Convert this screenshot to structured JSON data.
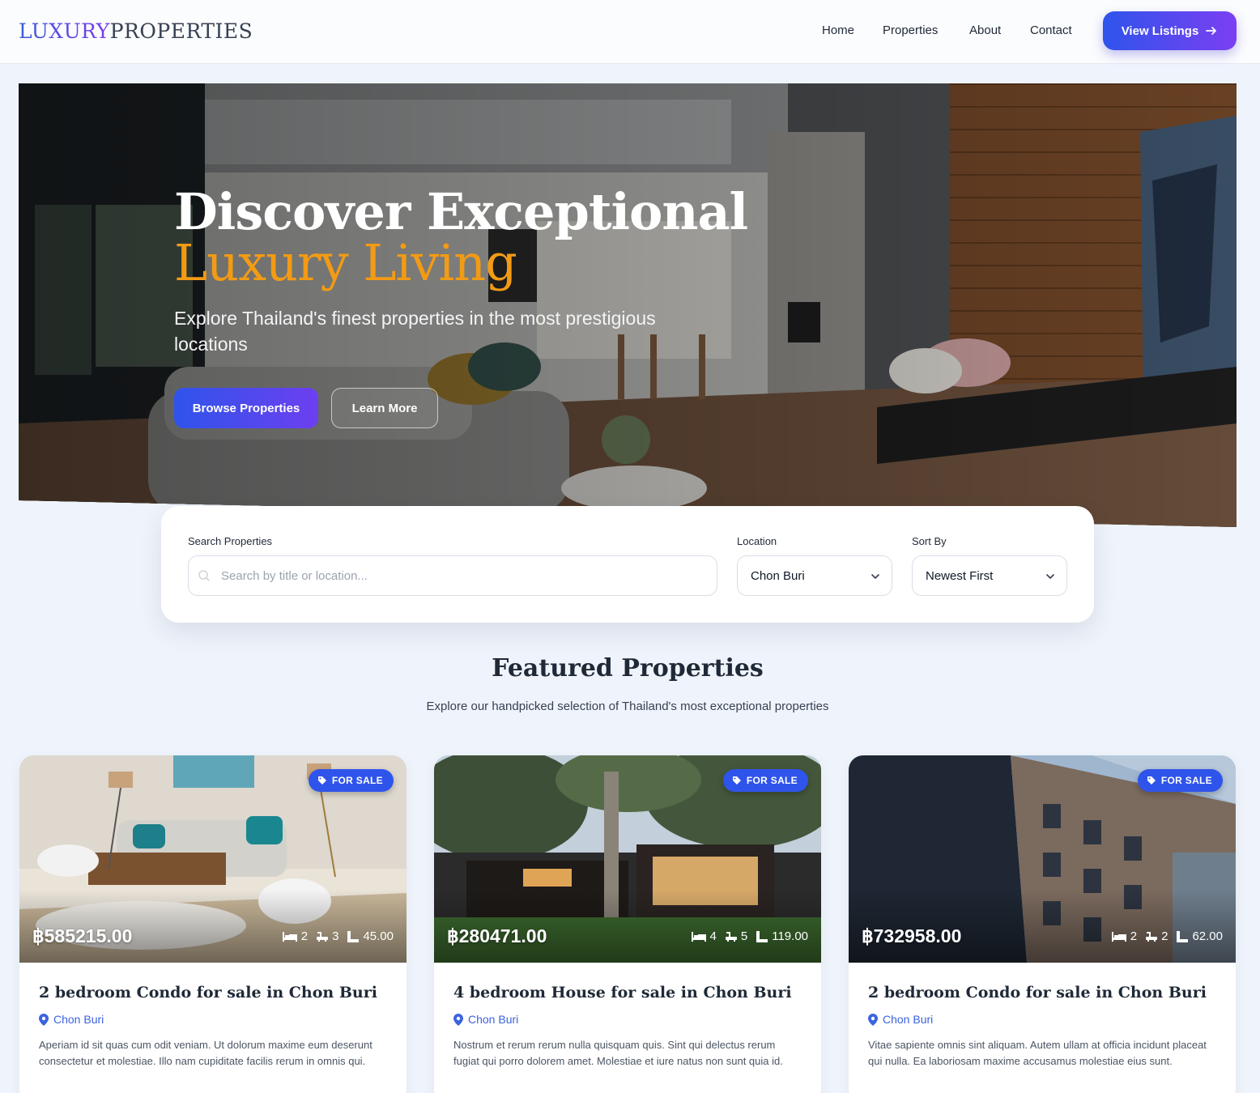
{
  "brand": {
    "logo_accent": "LUXURY",
    "logo_rest": "PROPERTIES"
  },
  "nav": {
    "items": [
      {
        "label": "Home"
      },
      {
        "label": "Properties"
      },
      {
        "label": "About"
      },
      {
        "label": "Contact"
      }
    ],
    "cta_label": "View Listings",
    "cta_icon": "arrow-right-icon"
  },
  "hero": {
    "title_line1": "Discover Exceptional",
    "title_line2": "Luxury Living",
    "subtitle": "Explore Thailand's finest properties in the most prestigious locations",
    "primary_button": "Browse Properties",
    "secondary_button": "Learn More"
  },
  "search": {
    "label": "Search Properties",
    "placeholder": "Search by title or location...",
    "location_label": "Location",
    "location_value": "Chon Buri",
    "sort_label": "Sort By",
    "sort_value": "Newest First"
  },
  "featured": {
    "title": "Featured Properties",
    "subtitle": "Explore our handpicked selection of Thailand's most exceptional properties"
  },
  "listings": [
    {
      "badge": "FOR SALE",
      "price": "฿585215.00",
      "beds": "2",
      "baths": "3",
      "area": "45.00",
      "title": "2 bedroom Condo for sale in Chon Buri",
      "location": "Chon Buri",
      "description": "Aperiam id sit quas cum odit veniam. Ut dolorum maxime eum deserunt consectetur et molestiae. Illo nam cupiditate facilis rerum in omnis qui."
    },
    {
      "badge": "FOR SALE",
      "price": "฿280471.00",
      "beds": "4",
      "baths": "5",
      "area": "119.00",
      "title": "4 bedroom House for sale in Chon Buri",
      "location": "Chon Buri",
      "description": "Nostrum et rerum rerum nulla quisquam quis. Sint qui delectus rerum fugiat qui porro dolorem amet. Molestiae et iure natus non sunt quia id."
    },
    {
      "badge": "FOR SALE",
      "price": "฿732958.00",
      "beds": "2",
      "baths": "2",
      "area": "62.00",
      "title": "2 bedroom Condo for sale in Chon Buri",
      "location": "Chon Buri",
      "description": "Vitae sapiente omnis sint aliquam. Autem ullam at officia incidunt placeat qui nulla. Ea laboriosam maxime accusamus molestiae eius sunt."
    }
  ],
  "colors": {
    "accent_blue": "#2f54eb",
    "accent_purple": "#7b3ff2",
    "hero_gold": "#f29b14",
    "location_blue": "#3b63e0"
  }
}
